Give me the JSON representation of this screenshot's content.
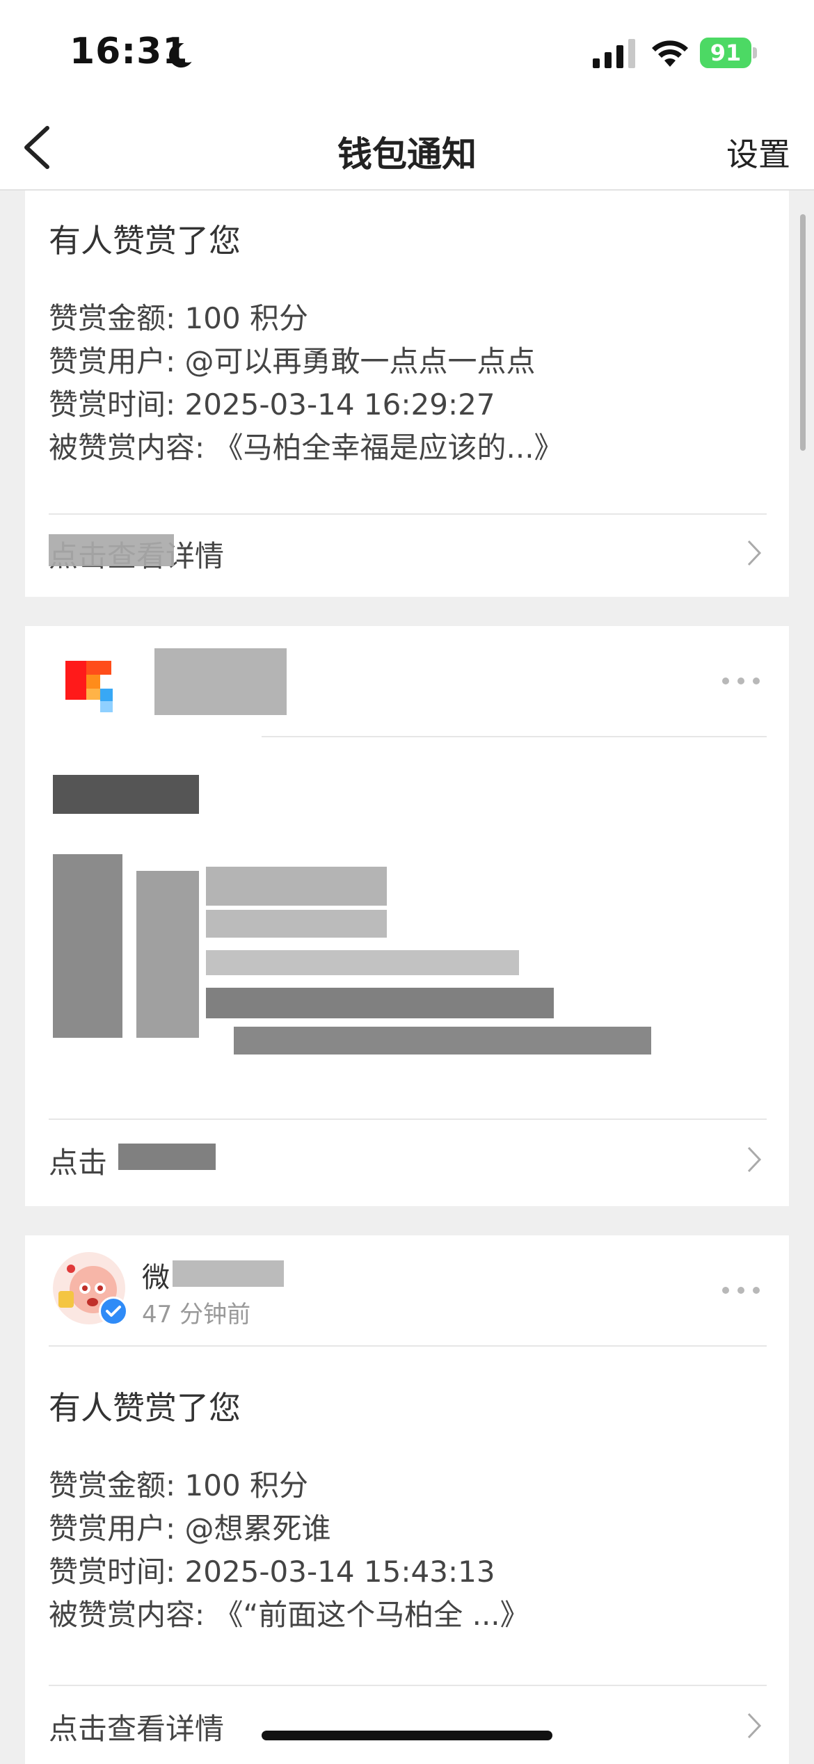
{
  "status_bar": {
    "time": "16:31",
    "battery": "91"
  },
  "nav": {
    "title": "钱包通知",
    "settings": "设置"
  },
  "card1": {
    "title": "有人赞赏了您",
    "lines": [
      "赞赏金额: 100 积分",
      "赞赏用户: @可以再勇敢一点点一点点",
      "赞赏时间: 2025-03-14 16:29:27",
      "被赞赏内容: 《马柏全幸福是应该的...》"
    ],
    "detail": "点击查看详情"
  },
  "card2": {
    "detail_prefix": "点击"
  },
  "card3": {
    "sender_name": "微",
    "time_ago": "47 分钟前",
    "title": "有人赞赏了您",
    "lines": [
      "赞赏金额: 100 积分",
      "赞赏用户: @想累死谁",
      "赞赏时间: 2025-03-14 15:43:13",
      "被赞赏内容: 《“前面这个马柏全 ...》"
    ],
    "detail": "点击查看详情"
  },
  "colors": {
    "background": "#efefef",
    "card": "#ffffff",
    "battery": "#4cd964",
    "verified": "#2f8bf7"
  }
}
